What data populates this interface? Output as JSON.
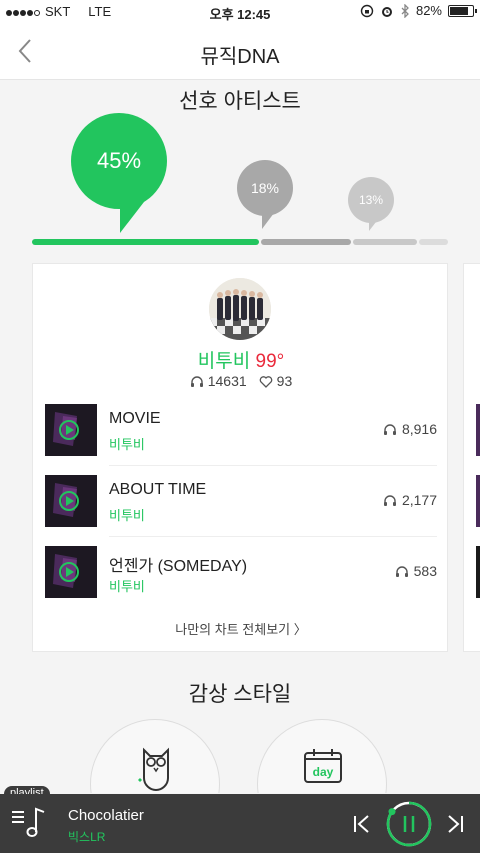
{
  "status_bar": {
    "carrier": "SKT",
    "network": "LTE",
    "time": "오후 12:45",
    "battery": "82%",
    "battery_level": 0.82
  },
  "nav": {
    "back_icon": "chevron-left-icon",
    "title": "뮤직DNA"
  },
  "favorite_artists": {
    "title": "선호 아티스트",
    "shares": [
      {
        "label": "45%",
        "value": 45,
        "color": "#22c55e"
      },
      {
        "label": "18%",
        "value": 18,
        "color": "#a8a8a8"
      },
      {
        "label": "13%",
        "value": 13,
        "color": "#c8c8c8"
      }
    ]
  },
  "artist_card": {
    "name": "비투비",
    "temperature": "99°",
    "listens": "14631",
    "likes": "93",
    "songs": [
      {
        "title": "MOVIE",
        "artist": "비투비",
        "plays": "8,916"
      },
      {
        "title": "ABOUT TIME",
        "artist": "비투비",
        "plays": "2,177"
      },
      {
        "title": "언젠가 (SOMEDAY)",
        "artist": "비투비",
        "plays": "583"
      }
    ],
    "view_all": "나만의 차트 전체보기 〉"
  },
  "listening_style": {
    "title": "감상 스타일",
    "items": [
      {
        "icon": "owl-icon"
      },
      {
        "icon": "calendar-day-icon",
        "label": "day"
      }
    ]
  },
  "player": {
    "playlist_tag": "playlist",
    "song_title": "Chocolatier",
    "song_artist": "빅스LR",
    "progress": 0.85,
    "accent": "#22c55e"
  },
  "colors": {
    "accent": "#22c55e",
    "temperature": "#ea2a3c"
  }
}
